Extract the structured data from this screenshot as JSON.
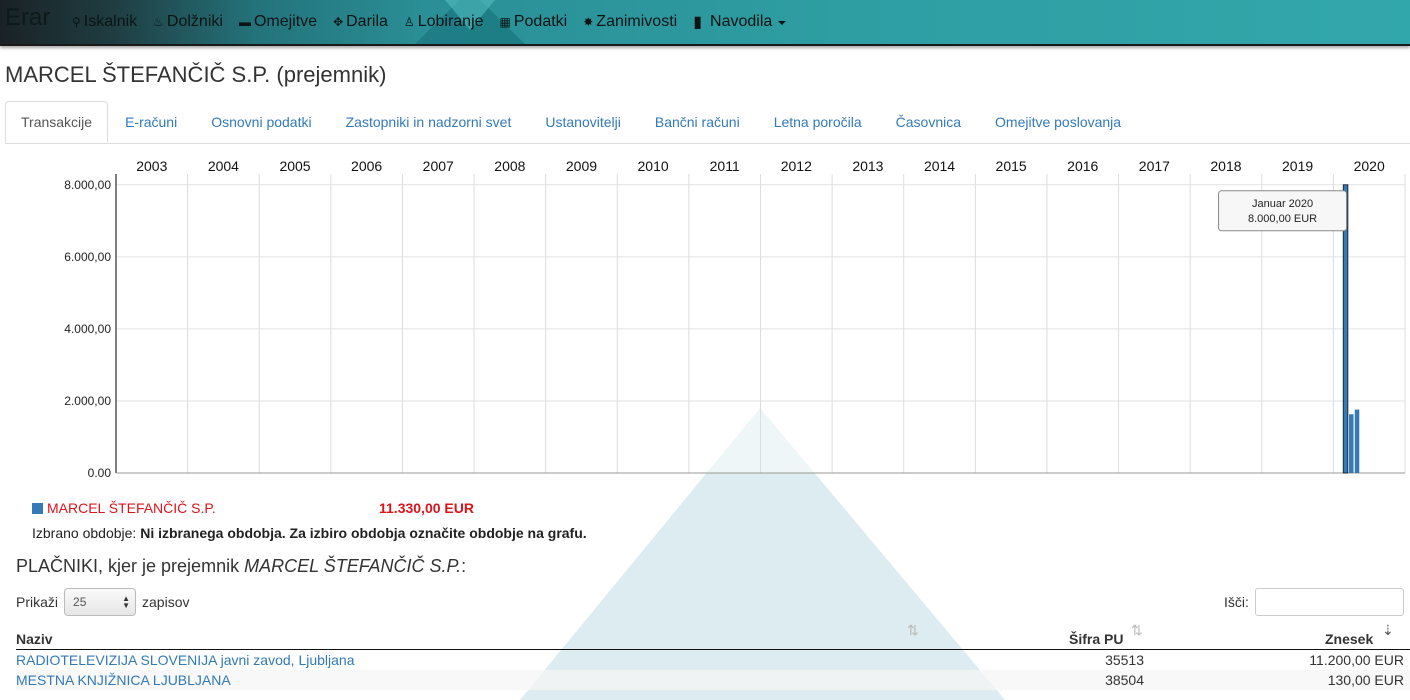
{
  "nav": {
    "brand": "Erar",
    "items": [
      {
        "label": "Iskalnik",
        "icon": "search-icon",
        "glyph": "⚲"
      },
      {
        "label": "Dolžniki",
        "icon": "fire-icon",
        "glyph": "♨"
      },
      {
        "label": "Omejitve",
        "icon": "briefcase-icon",
        "glyph": "▬"
      },
      {
        "label": "Darila",
        "icon": "gift-icon",
        "glyph": "✥"
      },
      {
        "label": "Lobiranje",
        "icon": "pawn-icon",
        "glyph": "♙"
      },
      {
        "label": "Podatki",
        "icon": "grid-icon",
        "glyph": "▦"
      },
      {
        "label": "Zanimivosti",
        "icon": "asterisk-icon",
        "glyph": "✸"
      },
      {
        "label": "Navodila",
        "icon": "book-icon",
        "glyph": "▮"
      }
    ]
  },
  "page": {
    "title": "MARCEL ŠTEFANČIČ S.P. (prejemnik)"
  },
  "tabs": [
    {
      "label": "Transakcije",
      "active": true
    },
    {
      "label": "E-računi"
    },
    {
      "label": "Osnovni podatki"
    },
    {
      "label": "Zastopniki in nadzorni svet"
    },
    {
      "label": "Ustanovitelji"
    },
    {
      "label": "Bančni računi"
    },
    {
      "label": "Letna poročila"
    },
    {
      "label": "Časovnica"
    },
    {
      "label": "Omejitve poslovanja"
    }
  ],
  "chart_data": {
    "type": "bar",
    "x_ticks": [
      "2003",
      "2004",
      "2005",
      "2006",
      "2007",
      "2008",
      "2009",
      "2010",
      "2011",
      "2012",
      "2013",
      "2014",
      "2015",
      "2016",
      "2017",
      "2018",
      "2019",
      "2020"
    ],
    "x_range": [
      2002.5,
      2020.5
    ],
    "y_ticks": [
      0,
      2000,
      4000,
      6000,
      8000
    ],
    "y_tick_labels": [
      "0.00",
      "2.000,00",
      "4.000,00",
      "6.000,00",
      "8.000,00"
    ],
    "ylim": [
      0,
      8300
    ],
    "grid": true,
    "color": "#337ab7",
    "series": [
      {
        "name": "MARCEL ŠTEFANČIČ S.P.",
        "points": [
          {
            "x": 2019.67,
            "value": 8000,
            "highlighted": true
          },
          {
            "x": 2019.75,
            "value": 1630
          },
          {
            "x": 2019.83,
            "value": 1760
          }
        ]
      }
    ],
    "tooltip": {
      "line1": "Januar 2020",
      "line2": "8.000,00 EUR"
    }
  },
  "legend": {
    "name": "MARCEL ŠTEFANČIČ S.P.",
    "total": "11.330,00 EUR"
  },
  "period": {
    "label": "Izbrano obdobje:",
    "value": "Ni izbranega obdobja. Za izbiro obdobja označite obdobje na grafu."
  },
  "payers": {
    "heading_prefix": "PLAČNIKI, kjer je prejemnik",
    "heading_name": "MARCEL ŠTEFANČIČ S.P.",
    "heading_suffix": ":",
    "show_label": "Prikaži",
    "show_value": "25",
    "show_suffix": "zapisov",
    "search_label": "Išči:",
    "columns": [
      "Naziv",
      "Šifra PU",
      "Znesek"
    ],
    "rows": [
      {
        "name": "RADIOTELEVIZIJA SLOVENIJA javni zavod, Ljubljana",
        "code": "35513",
        "amount": "11.200,00 EUR"
      },
      {
        "name": "MESTNA KNJIŽNICA LJUBLJANA",
        "code": "38504",
        "amount": "130,00 EUR"
      }
    ]
  }
}
